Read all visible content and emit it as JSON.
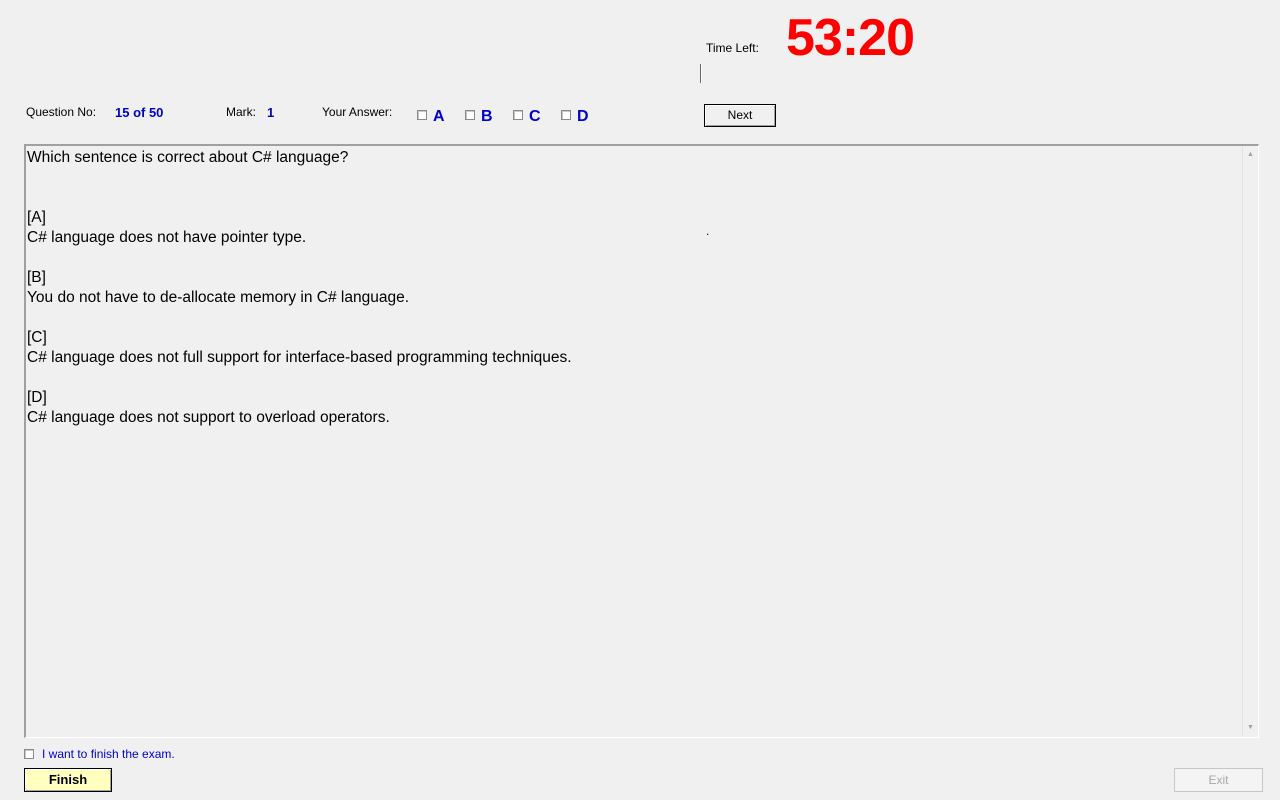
{
  "timer": {
    "label": "Time Left:",
    "value": "53:20",
    "color": "#ff0000"
  },
  "info": {
    "question_no_label": "Question No:",
    "question_no_value": "15 of 50",
    "mark_label": "Mark:",
    "mark_value": "1",
    "your_answer_label": "Your Answer:",
    "answer_options": [
      {
        "letter": "A",
        "checked": false
      },
      {
        "letter": "B",
        "checked": false
      },
      {
        "letter": "C",
        "checked": false
      },
      {
        "letter": "D",
        "checked": false
      }
    ],
    "next_label": "Next"
  },
  "question": {
    "text": "Which sentence is correct about C# language?",
    "options": [
      {
        "tag": "[A]",
        "text": "C# language does not have pointer type."
      },
      {
        "tag": "[B]",
        "text": "You do not have to de-allocate memory in C# language."
      },
      {
        "tag": "[C]",
        "text": "C# language does not full support for interface-based programming techniques."
      },
      {
        "tag": "[D]",
        "text": "C# language does not support to overload operators."
      }
    ],
    "stray_mark": "."
  },
  "footer": {
    "finish_checkbox_label": "I want to finish the exam.",
    "finish_checked": false,
    "finish_label": "Finish",
    "exit_label": "Exit"
  },
  "colors": {
    "accent_blue": "#0000cc",
    "finish_bg": "#ffffc0",
    "background": "#f0f0f0"
  }
}
